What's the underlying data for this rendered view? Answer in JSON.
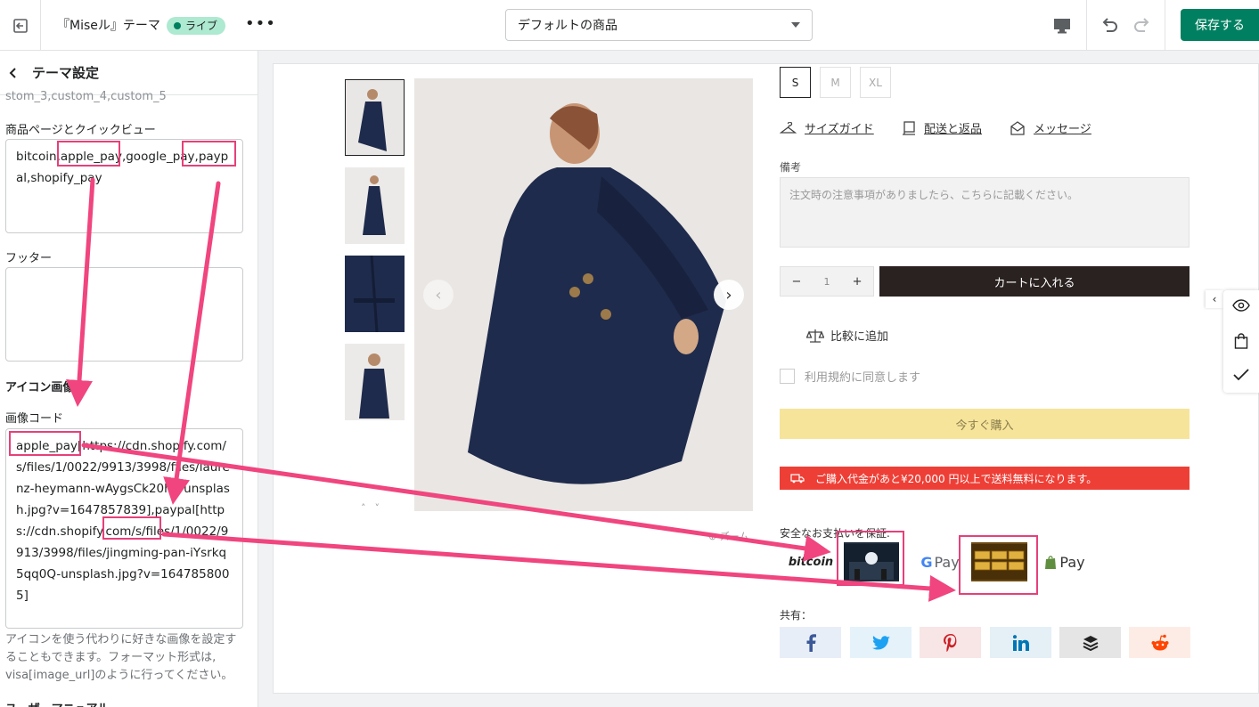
{
  "topbar": {
    "title": "『Miseル』テーマ",
    "badge": "ライブ",
    "template_select": "デフォルトの商品",
    "save_label": "保存する"
  },
  "sidebar": {
    "header": "テーマ設定",
    "cut_text": "stom_3,custom_4,custom_5",
    "product_label": "商品ページとクイックビュー",
    "product_value": "bitcoin,apple_pay,google_pay,paypal,shopify_pay",
    "footer_label": "フッター",
    "footer_value": "",
    "icon_heading": "アイコン画像",
    "image_code_label": "画像コード",
    "image_code_value": "apple_pay[https://cdn.shopify.com/s/files/1/0022/9913/3998/files/laurenz-heymann-wAygsCk20h8-unsplash.jpg?v=1647857839],paypal[https://cdn.shopify.com/s/files/1/0022/9913/3998/files/jingming-pan-iYsrkq5qq0Q-unsplash.jpg?v=1647858005]",
    "help_text": "アイコンを使う代わりに好きな画像を設定することもできます。フォーマット形式は, visa[image_url]のように行ってください。",
    "last_heading": "ユーザーマニュアル"
  },
  "product": {
    "sizes": [
      "S",
      "M",
      "XL"
    ],
    "selected_size": "S",
    "size_guide": "サイズガイド",
    "shipping_returns": "配送と返品",
    "message": "メッセージ",
    "notes_label": "備考",
    "notes_placeholder": "注文時の注意事項がありましたら、こちらに記載ください。",
    "qty_minus": "−",
    "quantity": "1",
    "qty_plus": "+",
    "add_to_cart": "カートに入れる",
    "compare": "比較に追加",
    "terms": "利用規約に同意します",
    "buy_now": "今すぐ購入",
    "shipping_notice": "ご購入代金があと¥20,000 円以上で送料無料になります。",
    "zoom": "ズーム",
    "secure_payment": "安全なお支払いを保証.",
    "payments": [
      "bitcoin",
      "apple_pay",
      "google_pay",
      "paypal",
      "shopify_pay"
    ],
    "payment_labels": {
      "bitcoin": "bitcoin",
      "gpay_g": "G",
      "gpay_pay": "Pay",
      "spay": "Pay"
    },
    "share_label": "共有：",
    "share_networks": [
      "facebook",
      "twitter",
      "pinterest",
      "linkedin",
      "buffer",
      "reddit"
    ]
  },
  "colors": {
    "save_green": "#008060",
    "annotation_pink": "#e6407a",
    "cart_dark": "#2a2121",
    "buy_yellow": "#f7e49b",
    "notice_red": "#ee3f36",
    "coat_navy": "#1f2b4c"
  }
}
